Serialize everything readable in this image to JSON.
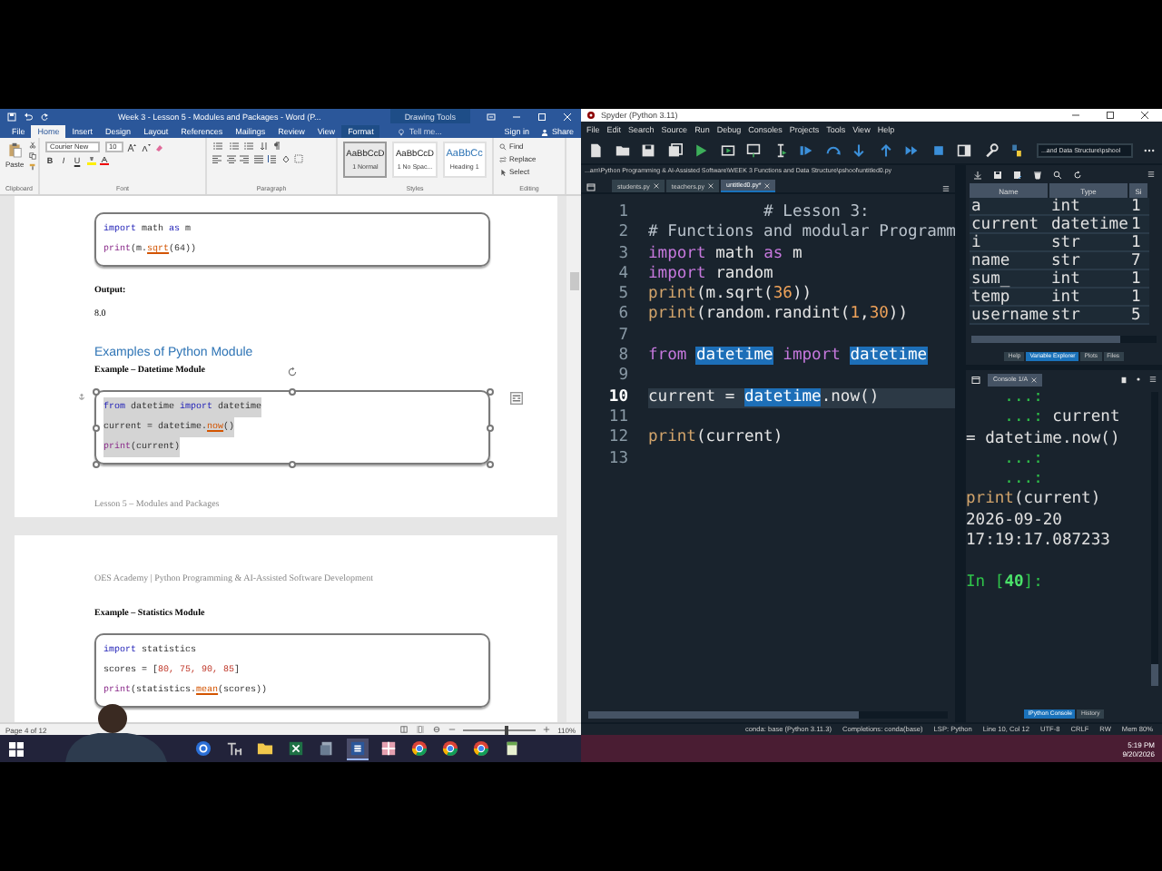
{
  "word": {
    "title": "Week 3 - Lesson 5 - Modules and Packages - Word (P...",
    "context_label": "Drawing Tools",
    "tabs": [
      {
        "label": "File",
        "selected": false,
        "kind": "standard"
      },
      {
        "label": "Home",
        "selected": true,
        "kind": "standard"
      },
      {
        "label": "Insert",
        "selected": false,
        "kind": "standard"
      },
      {
        "label": "Design",
        "selected": false,
        "kind": "standard"
      },
      {
        "label": "Layout",
        "selected": false,
        "kind": "standard"
      },
      {
        "label": "References",
        "selected": false,
        "kind": "standard"
      },
      {
        "label": "Mailings",
        "selected": false,
        "kind": "standard"
      },
      {
        "label": "Review",
        "selected": false,
        "kind": "standard"
      },
      {
        "label": "View",
        "selected": false,
        "kind": "standard"
      },
      {
        "label": "Format",
        "selected": false,
        "kind": "contextual"
      }
    ],
    "tell_me": "Tell me...",
    "sign_in": "Sign in",
    "share": "Share",
    "ribbon": {
      "paste": "Paste",
      "font_name": "Courier New",
      "font_size": "10",
      "format_buttons": [
        "B",
        "I",
        "U"
      ],
      "styles": [
        {
          "preview": "AaBbCcD",
          "name": "1 Normal",
          "selected": true,
          "kind": "body"
        },
        {
          "preview": "AaBbCcD",
          "name": "1 No Spac...",
          "selected": false,
          "kind": "body"
        },
        {
          "preview": "AaBbCc",
          "name": "Heading 1",
          "selected": false,
          "kind": "heading"
        }
      ],
      "editing": [
        "Find",
        "Replace",
        "Select"
      ],
      "group_labels": [
        "Clipboard",
        "Font",
        "Paragraph",
        "Styles",
        "Editing"
      ]
    },
    "pages": [
      {
        "blocks": [
          {
            "kind": "code",
            "selected": false,
            "lines": [
              [
                {
                  "text": "import",
                  "kind": "keyword"
                },
                {
                  "text": " math ",
                  "kind": "plain"
                },
                {
                  "text": "as",
                  "kind": "keyword"
                },
                {
                  "text": " m",
                  "kind": "plain"
                }
              ],
              [
                {
                  "text": "print",
                  "kind": "builtin"
                },
                {
                  "text": "(m.",
                  "kind": "plain"
                },
                {
                  "text": "sqrt",
                  "kind": "method"
                },
                {
                  "text": "(64))",
                  "kind": "plain"
                }
              ]
            ]
          },
          {
            "kind": "label",
            "text": "Output:"
          },
          {
            "kind": "text",
            "text": "8.0"
          },
          {
            "kind": "heading",
            "text": "Examples of Python Module"
          },
          {
            "kind": "subheading",
            "text": "Example – Datetime Module"
          },
          {
            "kind": "code",
            "selected": true,
            "lines": [
              [
                {
                  "text": "from",
                  "kind": "keyword"
                },
                {
                  "text": " datetime ",
                  "kind": "plain"
                },
                {
                  "text": "import",
                  "kind": "keyword"
                },
                {
                  "text": " datetime",
                  "kind": "plain"
                }
              ],
              [
                {
                  "text": "current = datetime.",
                  "kind": "plain"
                },
                {
                  "text": "now",
                  "kind": "method"
                },
                {
                  "text": "()",
                  "kind": "plain"
                }
              ],
              [
                {
                  "text": "print",
                  "kind": "builtin"
                },
                {
                  "text": "(current)",
                  "kind": "plain"
                }
              ]
            ]
          },
          {
            "kind": "footer",
            "text": "Lesson 5 – Modules and Packages"
          }
        ]
      },
      {
        "blocks": [
          {
            "kind": "header",
            "text": "OES Academy | Python Programming & AI-Assisted Software Development"
          },
          {
            "kind": "subheading",
            "text": "Example – Statistics Module"
          },
          {
            "kind": "code",
            "selected": false,
            "lines": [
              [
                {
                  "text": "import",
                  "kind": "keyword"
                },
                {
                  "text": " statistics",
                  "kind": "plain"
                }
              ],
              [
                {
                  "text": "scores = [",
                  "kind": "plain"
                },
                {
                  "text": "80, 75, 90, 85",
                  "kind": "number"
                },
                {
                  "text": "]",
                  "kind": "plain"
                }
              ],
              [
                {
                  "text": "print",
                  "kind": "builtin"
                },
                {
                  "text": "(statistics.",
                  "kind": "plain"
                },
                {
                  "text": "mean",
                  "kind": "method"
                },
                {
                  "text": "(scores))",
                  "kind": "plain"
                }
              ]
            ]
          }
        ]
      }
    ],
    "status_bar": {
      "page": "Page 4 of 12",
      "zoom_slider": {
        "level": 0.6
      },
      "zoom": "110%"
    }
  },
  "spyder": {
    "title": "Spyder (Python 3.11)",
    "menu": [
      "File",
      "Edit",
      "Search",
      "Source",
      "Run",
      "Debug",
      "Consoles",
      "Projects",
      "Tools",
      "View",
      "Help"
    ],
    "working_dir": "...and Data Structure\\pshool",
    "editor": {
      "path": "...am\\Python Programming & AI-Assisted Software\\WEEK 3 Functions and Data Structure\\pshool\\untitled0.py",
      "tabs": [
        {
          "label": "students.py",
          "selected": false
        },
        {
          "label": "teachers.py",
          "selected": false
        },
        {
          "label": "untitled0.py*",
          "selected": true
        }
      ],
      "lines": [
        {
          "number": "1",
          "current": false,
          "tokens": [
            {
              "text": "            # Lesson 3:",
              "kind": "comment"
            }
          ]
        },
        {
          "number": "2",
          "current": false,
          "tokens": [
            {
              "text": "# Functions and modular Programm",
              "kind": "comment"
            }
          ]
        },
        {
          "number": "3",
          "current": false,
          "tokens": [
            {
              "text": "import",
              "kind": "keyword"
            },
            {
              "text": " math ",
              "kind": "plain"
            },
            {
              "text": "as",
              "kind": "keyword"
            },
            {
              "text": " m",
              "kind": "plain"
            }
          ]
        },
        {
          "number": "4",
          "current": false,
          "tokens": [
            {
              "text": "import",
              "kind": "keyword"
            },
            {
              "text": " random",
              "kind": "plain"
            }
          ]
        },
        {
          "number": "5",
          "current": false,
          "tokens": [
            {
              "text": "print",
              "kind": "builtin"
            },
            {
              "text": "(m.sqrt(",
              "kind": "plain"
            },
            {
              "text": "36",
              "kind": "number"
            },
            {
              "text": "))",
              "kind": "plain"
            }
          ]
        },
        {
          "number": "6",
          "current": false,
          "tokens": [
            {
              "text": "print",
              "kind": "builtin"
            },
            {
              "text": "(random.randint(",
              "kind": "plain"
            },
            {
              "text": "1",
              "kind": "number"
            },
            {
              "text": ",",
              "kind": "plain"
            },
            {
              "text": "30",
              "kind": "number"
            },
            {
              "text": "))",
              "kind": "plain"
            }
          ]
        },
        {
          "number": "7",
          "current": false
        },
        {
          "number": "8",
          "current": false,
          "tokens": [
            {
              "text": "from ",
              "kind": "keyword"
            },
            {
              "text": "datetime",
              "kind": "highlight"
            },
            {
              "text": " import ",
              "kind": "keyword"
            },
            {
              "text": "datetime",
              "kind": "highlight"
            }
          ]
        },
        {
          "number": "9",
          "current": false
        },
        {
          "number": "10",
          "current": true,
          "tokens": [
            {
              "text": "current = ",
              "kind": "plain"
            },
            {
              "text": "datetime",
              "kind": "highlight"
            },
            {
              "text": ".now()",
              "kind": "plain"
            }
          ]
        },
        {
          "number": "11",
          "current": false
        },
        {
          "number": "12",
          "current": false,
          "tokens": [
            {
              "text": "print",
              "kind": "builtin"
            },
            {
              "text": "(current)",
              "kind": "plain"
            }
          ]
        },
        {
          "number": "13",
          "current": false
        }
      ]
    },
    "variable_explorer": {
      "columns": [
        "Name",
        "Type",
        "Si"
      ],
      "rows": [
        [
          "a",
          "int",
          "1"
        ],
        [
          "current",
          "datetime",
          "1"
        ],
        [
          "i",
          "str",
          "1"
        ],
        [
          "name",
          "str",
          "7"
        ],
        [
          "sum_",
          "int",
          "1"
        ],
        [
          "temp",
          "int",
          "1"
        ],
        [
          "username",
          "str",
          "5"
        ]
      ],
      "tabs": [
        {
          "label": "Help",
          "selected": false
        },
        {
          "label": "Variable Explorer",
          "selected": true
        },
        {
          "label": "Plots",
          "selected": false
        },
        {
          "label": "Files",
          "selected": false
        }
      ]
    },
    "console": {
      "tab": "Console 1/A",
      "lines": [
        {
          "kind": "text",
          "tokens": [
            {
              "text": "    ...:",
              "kind": "prompt"
            }
          ]
        },
        {
          "kind": "text",
          "tokens": [
            {
              "text": "    ...:",
              "kind": "prompt"
            },
            {
              "text": " current",
              "kind": "plain"
            }
          ]
        },
        {
          "kind": "text",
          "tokens": [
            {
              "text": "= datetime.now()",
              "kind": "plain"
            }
          ]
        },
        {
          "kind": "text",
          "tokens": [
            {
              "text": "    ...:",
              "kind": "prompt"
            }
          ]
        },
        {
          "kind": "text",
          "tokens": [
            {
              "text": "    ...:",
              "kind": "prompt"
            }
          ]
        },
        {
          "kind": "text",
          "tokens": [
            {
              "text": "print",
              "kind": "builtin"
            },
            {
              "text": "(current)",
              "kind": "plain"
            }
          ]
        },
        {
          "kind": "text",
          "tokens": [
            {
              "text": "2026-09-20",
              "kind": "plain"
            }
          ]
        },
        {
          "kind": "text",
          "tokens": [
            {
              "text": "17:19:17.087233",
              "kind": "plain"
            }
          ]
        },
        {
          "kind": "blank"
        },
        {
          "kind": "text",
          "tokens": [
            {
              "text": "In [",
              "kind": "prompt"
            },
            {
              "text": "40",
              "kind": "prompt_number"
            },
            {
              "text": "]:",
              "kind": "prompt"
            }
          ]
        }
      ],
      "tabs": [
        {
          "label": "IPython Console",
          "selected": true
        },
        {
          "label": "History",
          "selected": false
        }
      ]
    },
    "status_bar": [
      "conda: base (Python 3.11.3)",
      "Completions: conda(base)",
      "LSP: Python",
      "Line 10, Col 12",
      "UTF-8",
      "CRLF",
      "RW",
      "Mem 80%"
    ]
  },
  "taskbar": {
    "apps": [
      {
        "kind": "round",
        "active": false
      },
      {
        "kind": "letters",
        "active": false
      },
      {
        "kind": "folder",
        "active": false
      },
      {
        "kind": "spreadsheet",
        "active": false
      },
      {
        "kind": "notes",
        "active": false
      },
      {
        "kind": "document",
        "active": true
      },
      {
        "kind": "grid",
        "active": false
      },
      {
        "kind": "browser",
        "active": false
      },
      {
        "kind": "browser",
        "active": false
      },
      {
        "kind": "browser",
        "active": false
      },
      {
        "kind": "notepad",
        "active": false
      }
    ],
    "time": "5:19 PM",
    "date": "9/20/2026"
  }
}
